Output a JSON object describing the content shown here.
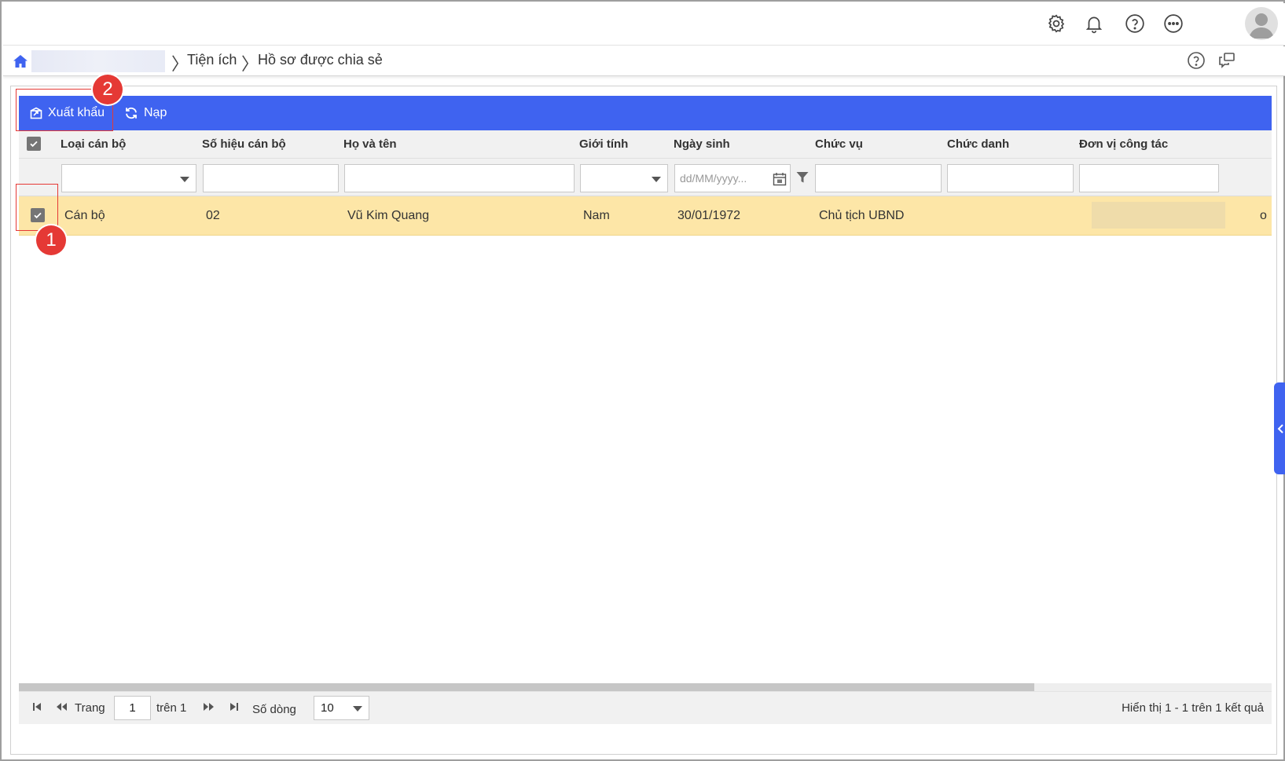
{
  "breadcrumb": {
    "items": [
      "Tiện ích",
      "Hồ sơ được chia sẻ"
    ]
  },
  "toolbar": {
    "export_label": "Xuất khẩu",
    "reload_label": "Nạp"
  },
  "grid": {
    "columns": [
      "Loại cán bộ",
      "Số hiệu cán bộ",
      "Họ và tên",
      "Giới tính",
      "Ngày sinh",
      "Chức vụ",
      "Chức danh",
      "Đơn vị công tác"
    ],
    "date_placeholder": "dd/MM/yyyy...",
    "rows": [
      {
        "selected": true,
        "loai_can_bo": "Cán bộ",
        "so_hieu": "02",
        "ho_ten": "Vũ Kim Quang",
        "gioi_tinh": "Nam",
        "ngay_sinh": "30/01/1972",
        "chuc_vu": "Chủ tịch UBND",
        "chuc_danh": "",
        "don_vi_tail": "o"
      }
    ]
  },
  "pager": {
    "page_label": "Trang",
    "page_value": "1",
    "of_label": "trên 1",
    "rows_label": "Số dòng",
    "rows_value": "10",
    "summary": "Hiển thị 1 - 1 trên 1 kết quả"
  },
  "annotations": {
    "step1": "1",
    "step2": "2"
  },
  "colors": {
    "accent": "#3f63f0",
    "selected_row": "#fde6a7",
    "callout": "#e53935"
  },
  "icons": [
    "settings-icon",
    "bell-icon",
    "help-icon",
    "more-icon",
    "avatar",
    "home-icon",
    "help-circle-icon",
    "feedback-icon",
    "export-icon",
    "reload-icon",
    "calendar-icon",
    "filter-icon",
    "first-page-icon",
    "prev-page-icon",
    "next-page-icon",
    "last-page-icon",
    "collapse-chevron-icon"
  ]
}
